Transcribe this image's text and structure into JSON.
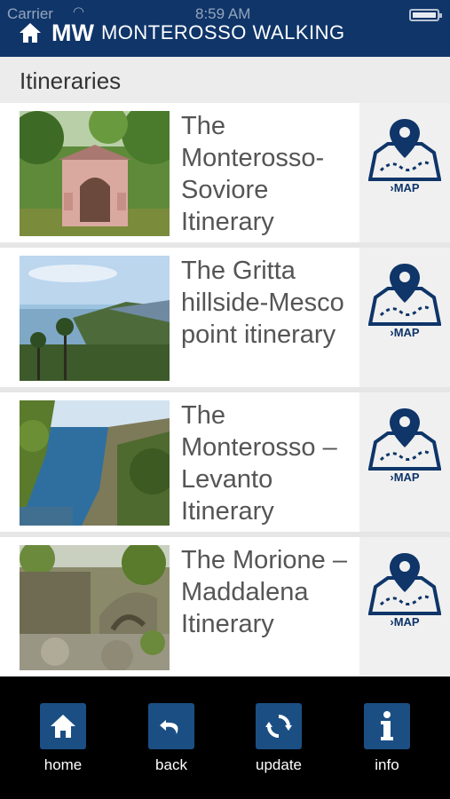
{
  "status_bar": {
    "carrier": "Carrier",
    "time": "8:59 AM"
  },
  "header": {
    "logo": "MW",
    "title": "MONTEROSSO WALKING"
  },
  "section": {
    "title": "Itineraries"
  },
  "itineraries": [
    {
      "title": "The Monterosso-Soviore Itinerary",
      "map_label": "›MAP"
    },
    {
      "title": "The Gritta hillside-Mesco point itinerary",
      "map_label": "›MAP"
    },
    {
      "title": "The Monterosso – Levanto Itinerary",
      "map_label": "›MAP"
    },
    {
      "title": "The Morione – Maddalena Itinerary",
      "map_label": "›MAP"
    }
  ],
  "nav": {
    "home": "home",
    "back": "back",
    "update": "update",
    "info": "info"
  },
  "colors": {
    "brand": "#0f3569",
    "nav_button": "#1b4f84"
  }
}
